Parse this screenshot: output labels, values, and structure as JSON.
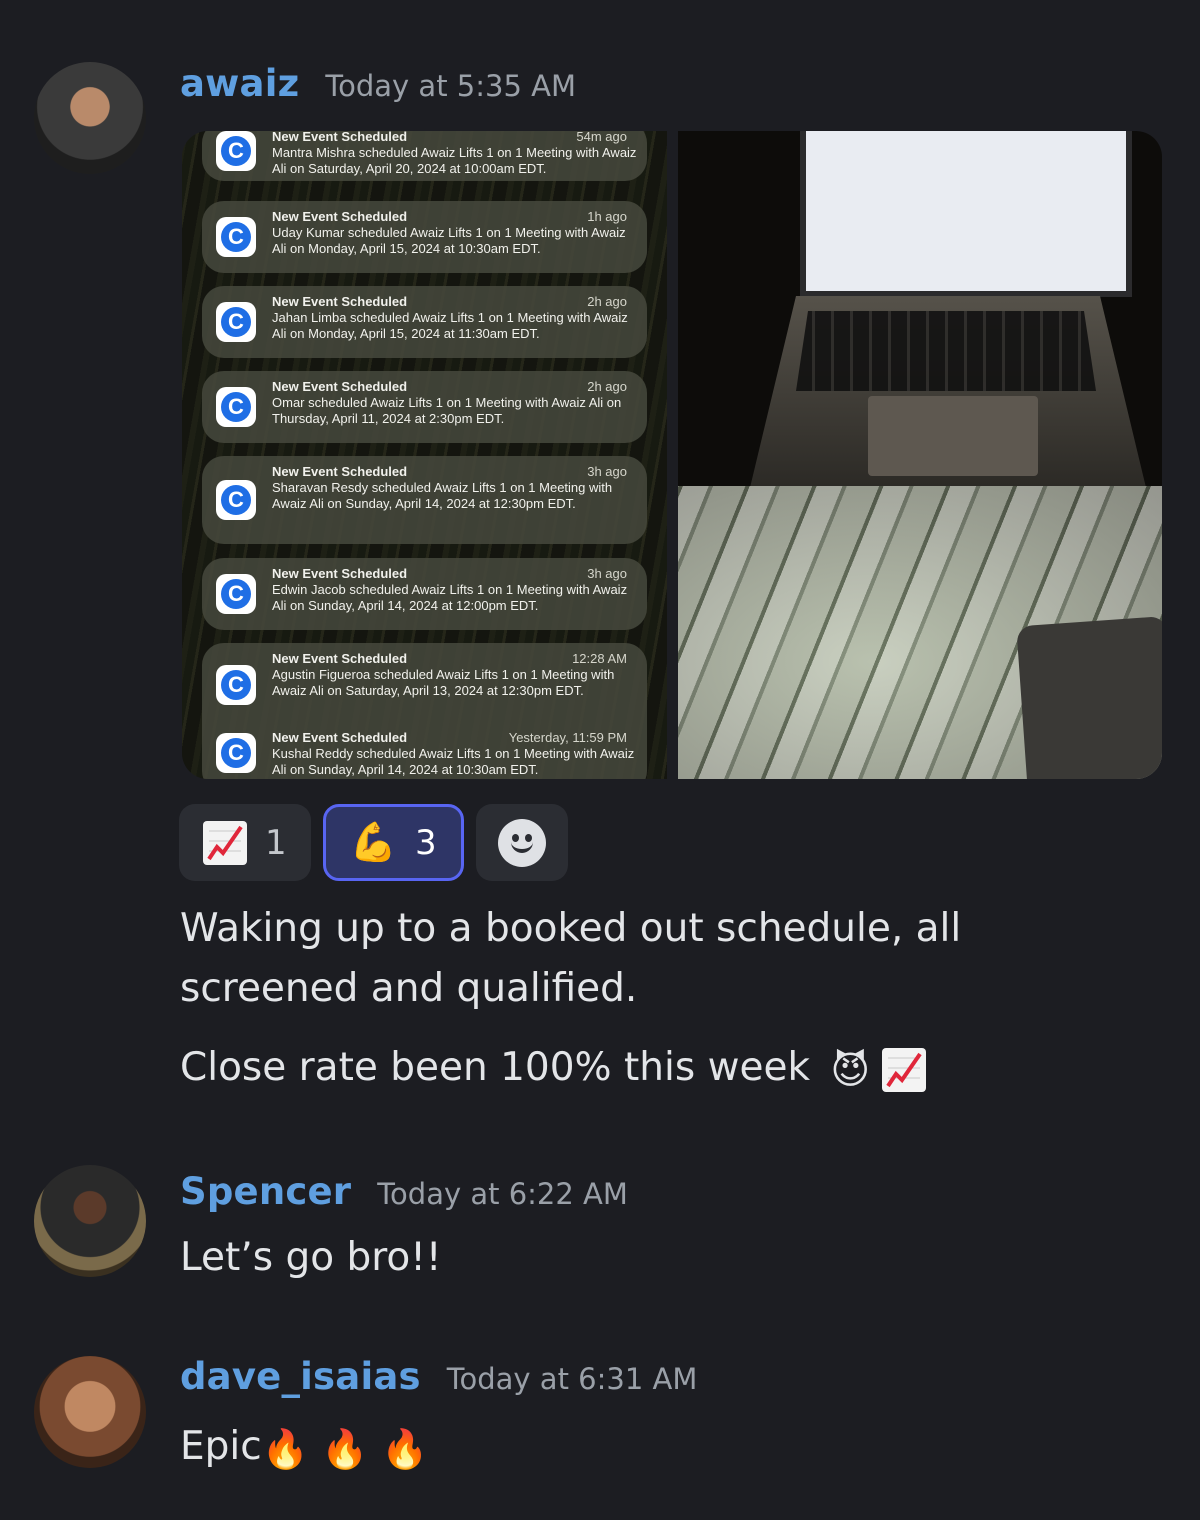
{
  "messages": [
    {
      "username": "awaiz",
      "timestamp": "Today at 5:35 AM",
      "notifications": [
        {
          "title": "New Event Scheduled",
          "time": "54m ago",
          "body": "Mantra Mishra scheduled Awaiz Lifts 1 on 1 Meeting with Awaiz Ali on Saturday, April 20, 2024 at 10:00am EDT."
        },
        {
          "title": "New Event Scheduled",
          "time": "1h ago",
          "body": "Uday Kumar  scheduled Awaiz Lifts 1 on 1 Meeting with Awaiz Ali on Monday, April 15, 2024 at 10:30am EDT."
        },
        {
          "title": "New Event Scheduled",
          "time": "2h ago",
          "body": "Jahan Limba scheduled Awaiz Lifts 1 on 1 Meeting with Awaiz Ali on Monday, April 15, 2024 at 11:30am EDT."
        },
        {
          "title": "New Event Scheduled",
          "time": "2h ago",
          "body": "Omar scheduled Awaiz Lifts 1 on 1 Meeting with Awaiz Ali on Thursday, April 11, 2024 at 2:30pm EDT."
        },
        {
          "title": "New Event Scheduled",
          "time": "3h ago",
          "body": "Sharavan Resdy scheduled Awaiz Lifts 1 on 1 Meeting with Awaiz Ali on Sunday, April 14, 2024 at 12:30pm EDT."
        },
        {
          "title": "New Event Scheduled",
          "time": "3h ago",
          "body": "Edwin Jacob scheduled Awaiz Lifts 1 on 1 Meeting with Awaiz Ali on Sunday, April 14, 2024 at 12:00pm EDT."
        },
        {
          "title": "New Event Scheduled",
          "time": "12:28 AM",
          "body": "Agustin Figueroa scheduled Awaiz Lifts 1 on 1 Meeting with Awaiz Ali on Saturday, April 13, 2024 at 12:30pm EDT."
        },
        {
          "title": "New Event Scheduled",
          "time": "Yesterday, 11:59 PM",
          "body": "Kushal Reddy scheduled Awaiz Lifts 1 on 1 Meeting with Awaiz Ali on Sunday, April 14, 2024 at 10:30am EDT."
        }
      ],
      "reactions": [
        {
          "emoji": "chart-increasing-icon",
          "count": "1"
        },
        {
          "emoji": "💪",
          "count": "3"
        }
      ],
      "text1": "Waking up to a booked out schedule, all screened and qualified.",
      "text2": "Close rate been 100% this week",
      "text2_emoji": "😈"
    },
    {
      "username": "Spencer",
      "timestamp": "Today at 6:22 AM",
      "text": "Let’s go bro!!"
    },
    {
      "username": "dave_isaias",
      "timestamp": "Today at 6:31 AM",
      "text": "Epic",
      "emoji": "🔥"
    }
  ],
  "colors": {
    "background": "#1c1d22",
    "username": "#5f9fe0",
    "timestamp": "#9aa0a8",
    "active_reaction_border": "#5865f2"
  }
}
